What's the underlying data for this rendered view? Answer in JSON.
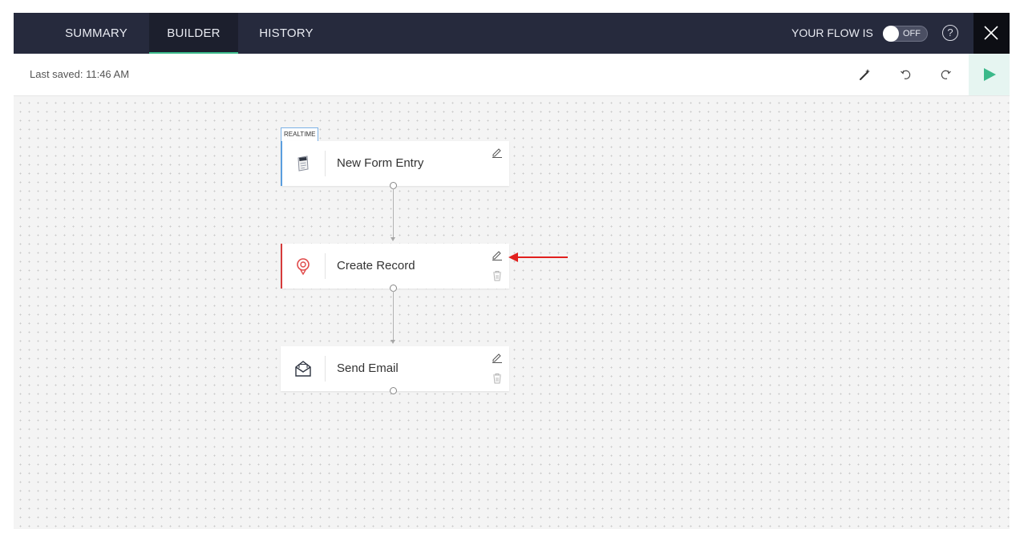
{
  "tabs": [
    {
      "label": "SUMMARY"
    },
    {
      "label": "BUILDER",
      "active": true
    },
    {
      "label": "HISTORY"
    }
  ],
  "flow_status": {
    "label": "YOUR FLOW IS",
    "toggle_text": "OFF"
  },
  "help_icon": {
    "text": "?"
  },
  "save_status": {
    "text": "Last saved: 11:46 AM"
  },
  "toolbar_icons": [
    "magic-wand-icon",
    "undo-icon",
    "redo-icon",
    "run-icon"
  ],
  "canvas": {
    "trigger_badge": "REALTIME",
    "nodes": [
      {
        "label": "New Form Entry",
        "icon": "form-icon",
        "accent": "#5a9ede"
      },
      {
        "label": "Create Record",
        "icon": "record-icon",
        "accent": "#d63b3b"
      },
      {
        "label": "Send Email",
        "icon": "email-icon",
        "accent": "#ffffff"
      }
    ]
  },
  "colors": {
    "topbar": "#262a3d",
    "active_tab": "#1c1f2d",
    "active_underline": "#3bb98a",
    "close_bg": "#0d0e14",
    "run_green": "#3bb98a",
    "annotation_red": "#e1201e"
  }
}
